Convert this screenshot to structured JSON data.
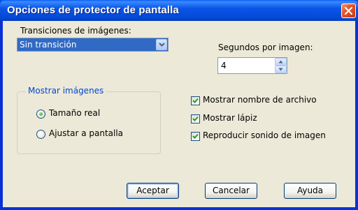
{
  "window": {
    "title": "Opciones de protector de pantalla"
  },
  "transitions": {
    "label": "Transiciones de imágenes:",
    "selected": "Sin transición"
  },
  "seconds": {
    "label": "Segundos por imagen:",
    "value": "4"
  },
  "show_images": {
    "legend": "Mostrar imágenes",
    "options": [
      {
        "label": "Tamaño real",
        "selected": true
      },
      {
        "label": "Ajustar a pantalla",
        "selected": false
      }
    ]
  },
  "checkboxes": [
    {
      "label": "Mostrar nombre de archivo",
      "checked": true
    },
    {
      "label": "Mostrar lápiz",
      "checked": true
    },
    {
      "label": "Reproducir sonido de imagen",
      "checked": true
    }
  ],
  "buttons": {
    "ok": "Aceptar",
    "cancel": "Cancelar",
    "help": "Ayuda"
  },
  "colors": {
    "titlebar": "#0a55e8",
    "close_button": "#e4552b",
    "dialog_face": "#ece9d8",
    "selection": "#316ac5",
    "group_legend": "#0046d5",
    "checkmark": "#21a121"
  },
  "icons": [
    "close-icon",
    "dropdown-arrow-icon",
    "spin-up-icon",
    "spin-down-icon",
    "checkmark-icon"
  ]
}
